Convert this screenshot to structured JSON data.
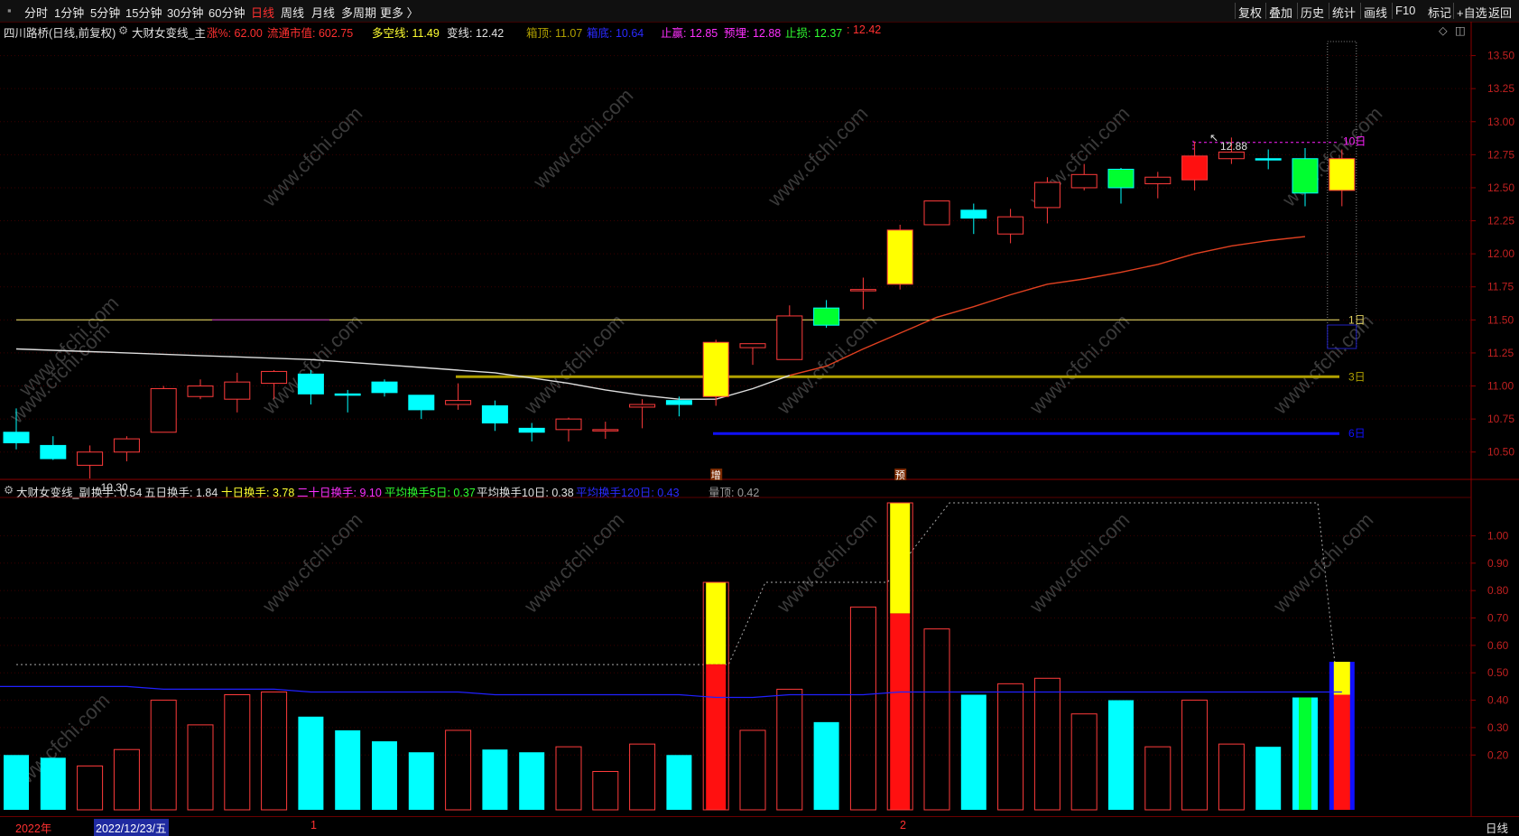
{
  "toolbar": {
    "periods": [
      "分时",
      "1分钟",
      "5分钟",
      "15分钟",
      "30分钟",
      "60分钟",
      "日线",
      "周线",
      "月线",
      "多周期",
      "更多 〉"
    ],
    "active_period": "日线",
    "right_items": [
      "复权",
      "叠加",
      "历史",
      "统计",
      "画线",
      "F10",
      "+自选",
      "返回"
    ],
    "mark_label": "标记"
  },
  "main_info": {
    "stock": "四川路桥(日线,前复权)",
    "indicator": "大财女变线_主",
    "zf": "涨%: 62.00",
    "ltsz": "流通市值: 602.75",
    "dkx": "多空线: 11.49",
    "bx": "变线: 12.42",
    "xd": "箱顶: 11.07",
    "xdi": "箱底: 10.64",
    "zy": "止赢: 12.85",
    "yl": "预埋: 12.88",
    "zs": "止损: 12.37",
    "last": ": 12.42"
  },
  "sub_info": {
    "indicator": "大财女变线_副",
    "hs": "换手: 0.54",
    "hs5": "五日换手: 1.84",
    "hs10": "十日换手: 3.78",
    "hs20": "二十日换手: 9.10",
    "avg5": "平均换手5日: 0.37",
    "avg10": "平均换手10日: 0.38",
    "avg120": "平均换手120日: 0.43",
    "ld": "量顶: 0.42"
  },
  "status": {
    "year": "2022年",
    "date": "2022/12/23/五",
    "m1": "1",
    "m2": "2",
    "period": "日线"
  },
  "labels": {
    "low": "←10.30",
    "high": "12.88",
    "d1": "1日",
    "d3": "3日",
    "d6": "6日",
    "d10": "10日",
    "zeng": "增",
    "yu": "预",
    "watermark": "www.cfchi.com"
  },
  "colors": {
    "up": "#ff3b3b",
    "down": "#00ffff",
    "yellow": "#ffff00",
    "green": "#00ff00",
    "blue": "#1010ff",
    "magenta": "#ff20ff",
    "olive": "#b0a000"
  },
  "chart_data": [
    {
      "type": "candlestick",
      "title": "四川路桥(日线,前复权)",
      "ylim": [
        10.3,
        13.62
      ],
      "y_ticks": [
        "13.50",
        "13.25",
        "13.00",
        "12.75",
        "12.50",
        "12.25",
        "12.00",
        "11.75",
        "11.50",
        "11.25",
        "11.00",
        "10.75",
        "10.50"
      ],
      "candles": [
        {
          "o": 10.65,
          "h": 10.83,
          "l": 10.52,
          "c": 10.57,
          "fill": "cyan"
        },
        {
          "o": 10.55,
          "h": 10.62,
          "l": 10.44,
          "c": 10.45,
          "fill": "cyan"
        },
        {
          "o": 10.4,
          "h": 10.55,
          "l": 10.3,
          "c": 10.5,
          "fill": "hollow"
        },
        {
          "o": 10.5,
          "h": 10.62,
          "l": 10.43,
          "c": 10.6,
          "fill": "hollow"
        },
        {
          "o": 10.65,
          "h": 11.0,
          "l": 10.65,
          "c": 10.98,
          "fill": "hollow"
        },
        {
          "o": 10.92,
          "h": 11.05,
          "l": 10.9,
          "c": 11.0,
          "fill": "hollow"
        },
        {
          "o": 10.9,
          "h": 11.1,
          "l": 10.8,
          "c": 11.03,
          "fill": "hollow"
        },
        {
          "o": 11.02,
          "h": 11.12,
          "l": 10.9,
          "c": 11.11,
          "fill": "hollow"
        },
        {
          "o": 11.09,
          "h": 11.12,
          "l": 10.86,
          "c": 10.94,
          "fill": "cyan"
        },
        {
          "o": 10.94,
          "h": 10.97,
          "l": 10.8,
          "c": 10.94,
          "fill": "cyan"
        },
        {
          "o": 11.03,
          "h": 11.05,
          "l": 10.92,
          "c": 10.95,
          "fill": "cyan"
        },
        {
          "o": 10.93,
          "h": 10.93,
          "l": 10.75,
          "c": 10.82,
          "fill": "cyan"
        },
        {
          "o": 10.86,
          "h": 11.02,
          "l": 10.82,
          "c": 10.89,
          "fill": "hollow"
        },
        {
          "o": 10.85,
          "h": 10.89,
          "l": 10.66,
          "c": 10.72,
          "fill": "cyan"
        },
        {
          "o": 10.68,
          "h": 10.72,
          "l": 10.58,
          "c": 10.65,
          "fill": "cyan"
        },
        {
          "o": 10.67,
          "h": 10.76,
          "l": 10.58,
          "c": 10.75,
          "fill": "hollow"
        },
        {
          "o": 10.67,
          "h": 10.73,
          "l": 10.6,
          "c": 10.67,
          "fill": "hollow"
        },
        {
          "o": 10.84,
          "h": 10.9,
          "l": 10.68,
          "c": 10.86,
          "fill": "hollow"
        },
        {
          "o": 10.89,
          "h": 10.92,
          "l": 10.77,
          "c": 10.86,
          "fill": "cyan"
        },
        {
          "o": 10.92,
          "h": 11.35,
          "l": 10.85,
          "c": 11.33,
          "fill": "yellow"
        },
        {
          "o": 11.29,
          "h": 11.32,
          "l": 11.16,
          "c": 11.32,
          "fill": "hollow"
        },
        {
          "o": 11.2,
          "h": 11.61,
          "l": 11.2,
          "c": 11.53,
          "fill": "hollow"
        },
        {
          "o": 11.59,
          "h": 11.65,
          "l": 11.44,
          "c": 11.46,
          "fill": "green"
        },
        {
          "o": 11.72,
          "h": 11.82,
          "l": 11.58,
          "c": 11.73,
          "fill": "hollow"
        },
        {
          "o": 11.77,
          "h": 12.22,
          "l": 11.73,
          "c": 12.18,
          "fill": "yellow"
        },
        {
          "o": 12.22,
          "h": 12.4,
          "l": 12.22,
          "c": 12.4,
          "fill": "hollow"
        },
        {
          "o": 12.33,
          "h": 12.38,
          "l": 12.15,
          "c": 12.27,
          "fill": "cyan"
        },
        {
          "o": 12.15,
          "h": 12.34,
          "l": 12.08,
          "c": 12.28,
          "fill": "hollow"
        },
        {
          "o": 12.35,
          "h": 12.58,
          "l": 12.23,
          "c": 12.54,
          "fill": "hollow"
        },
        {
          "o": 12.5,
          "h": 12.68,
          "l": 12.48,
          "c": 12.6,
          "fill": "hollow"
        },
        {
          "o": 12.64,
          "h": 12.65,
          "l": 12.38,
          "c": 12.5,
          "fill": "green"
        },
        {
          "o": 12.53,
          "h": 12.62,
          "l": 12.42,
          "c": 12.58,
          "fill": "hollow"
        },
        {
          "o": 12.56,
          "h": 12.85,
          "l": 12.48,
          "c": 12.74,
          "fill": "red"
        },
        {
          "o": 12.72,
          "h": 12.88,
          "l": 12.68,
          "c": 12.77,
          "fill": "hollow"
        },
        {
          "o": 12.72,
          "h": 12.79,
          "l": 12.64,
          "c": 12.72,
          "fill": "cyan"
        },
        {
          "o": 12.72,
          "h": 12.8,
          "l": 12.36,
          "c": 12.46,
          "fill": "green"
        },
        {
          "o": 12.48,
          "h": 12.79,
          "l": 12.36,
          "c": 12.72,
          "fill": "yellow"
        }
      ],
      "series": [
        {
          "name": "多空线",
          "values": [
            11.28,
            11.27,
            11.26,
            11.25,
            11.24,
            11.23,
            11.22,
            11.21,
            11.2,
            11.18,
            11.16,
            11.14,
            11.12,
            11.1,
            11.06,
            11.02,
            10.97,
            10.93,
            10.9,
            10.9,
            10.98,
            11.08,
            11.15,
            11.28,
            11.4,
            11.52,
            11.6,
            11.69,
            11.77,
            11.81,
            11.86,
            11.92,
            12.0,
            12.06,
            12.1,
            12.13,
            12.42
          ]
        },
        {
          "name": "变线",
          "values": [
            null,
            null,
            null,
            null,
            null,
            null,
            null,
            null,
            null,
            null,
            null,
            null,
            null,
            null,
            null,
            null,
            null,
            null,
            null,
            null,
            null,
            null,
            null,
            null,
            null,
            null,
            null,
            null,
            null,
            null,
            null,
            null,
            null,
            null,
            null,
            null,
            12.42
          ]
        }
      ],
      "levels": {
        "box_top": 11.07,
        "box_bottom": 10.64,
        "line_1d": 11.5,
        "stop_gain": 12.85
      }
    },
    {
      "type": "bar",
      "title": "大财女变线_副",
      "ylim": [
        0,
        1.12
      ],
      "y_ticks": [
        "1.00",
        "0.90",
        "0.80",
        "0.70",
        "0.60",
        "0.50",
        "0.40",
        "0.30",
        "0.20"
      ],
      "values": [
        0.2,
        0.19,
        0.16,
        0.22,
        0.4,
        0.31,
        0.42,
        0.43,
        0.34,
        0.29,
        0.25,
        0.21,
        0.29,
        0.22,
        0.21,
        0.23,
        0.14,
        0.24,
        0.2,
        0.83,
        0.29,
        0.44,
        0.32,
        0.74,
        1.12,
        0.66,
        0.42,
        0.46,
        0.48,
        0.35,
        0.4,
        0.23,
        0.4,
        0.24,
        0.23,
        0.41,
        0.54
      ],
      "kinds": [
        "cyan",
        "cyan",
        "hollow",
        "hollow",
        "hollow",
        "hollow",
        "hollow",
        "hollow",
        "cyan",
        "cyan",
        "cyan",
        "cyan",
        "hollow",
        "cyan",
        "cyan",
        "hollow",
        "hollow",
        "hollow",
        "cyan",
        "split",
        "hollow",
        "hollow",
        "cyan",
        "hollow",
        "split",
        "hollow",
        "cyan",
        "hollow",
        "hollow",
        "hollow",
        "cyan",
        "hollow",
        "hollow",
        "hollow",
        "cyan",
        "green",
        "last"
      ],
      "series": [
        {
          "name": "平均换手120日",
          "values": [
            0.45,
            0.45,
            0.45,
            0.45,
            0.44,
            0.44,
            0.44,
            0.44,
            0.43,
            0.43,
            0.43,
            0.43,
            0.43,
            0.42,
            0.42,
            0.42,
            0.42,
            0.42,
            0.42,
            0.41,
            0.41,
            0.42,
            0.42,
            0.42,
            0.43,
            0.43,
            0.43,
            0.43,
            0.43,
            0.43,
            0.43,
            0.43,
            0.43,
            0.43,
            0.43,
            0.43,
            0.43
          ]
        }
      ]
    }
  ]
}
